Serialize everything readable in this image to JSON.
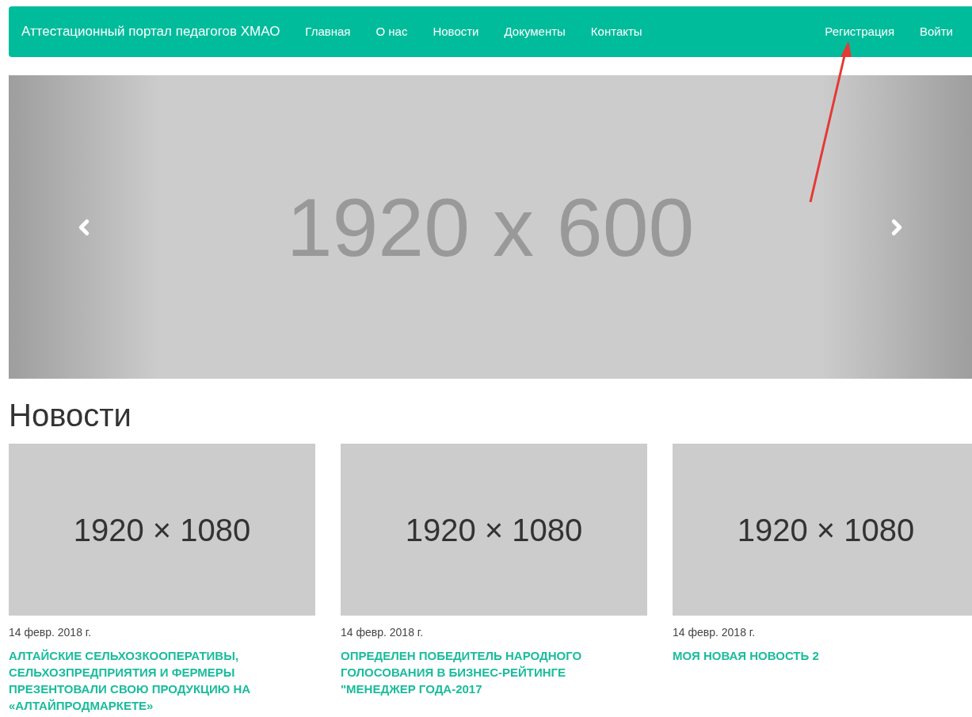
{
  "navbar": {
    "brand": "Аттестационный портал педагогов ХМАО",
    "links": [
      {
        "label": "Главная"
      },
      {
        "label": "О нас"
      },
      {
        "label": "Новости"
      },
      {
        "label": "Документы"
      },
      {
        "label": "Контакты"
      }
    ],
    "right_links": [
      {
        "label": "Регистрация"
      },
      {
        "label": "Войти"
      }
    ]
  },
  "carousel": {
    "placeholder_text": "1920 x 600"
  },
  "annotation": {
    "kind": "arrow",
    "color": "#e53935"
  },
  "news": {
    "heading": "Новости",
    "items": [
      {
        "image_text": "1920 × 1080",
        "date": "14 февр. 2018 г.",
        "title": "АЛТАЙСКИЕ СЕЛЬХОЗКООПЕРАТИВЫ, СЕЛЬХОЗПРЕДПРИЯТИЯ И ФЕРМЕРЫ ПРЕЗЕНТОВАЛИ СВОЮ ПРОДУКЦИЮ НА «АЛТАЙПРОДМАРКЕТЕ»"
      },
      {
        "image_text": "1920 × 1080",
        "date": "14 февр. 2018 г.",
        "title": "ОПРЕДЕЛЕН ПОБЕДИТЕЛЬ НАРОДНОГО ГОЛОСОВАНИЯ В БИЗНЕС-РЕЙТИНГЕ \"МЕНЕДЖЕР ГОДА-2017"
      },
      {
        "image_text": "1920 × 1080",
        "date": "14 февр. 2018 г.",
        "title": "МОЯ НОВАЯ НОВОСТЬ 2"
      }
    ]
  }
}
